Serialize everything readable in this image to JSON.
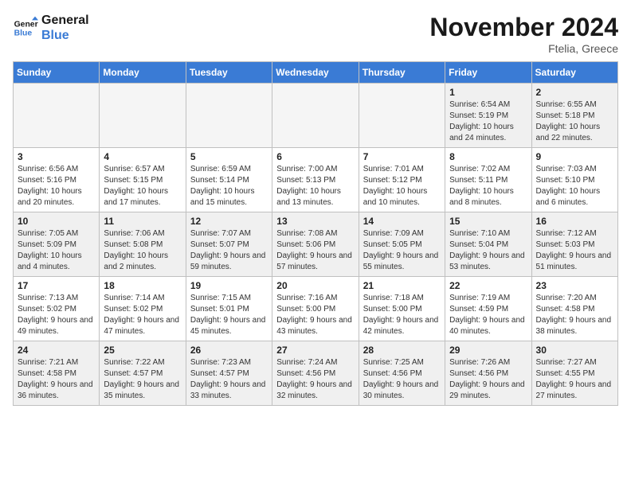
{
  "header": {
    "logo_line1": "General",
    "logo_line2": "Blue",
    "month_title": "November 2024",
    "location": "Ftelia, Greece"
  },
  "weekdays": [
    "Sunday",
    "Monday",
    "Tuesday",
    "Wednesday",
    "Thursday",
    "Friday",
    "Saturday"
  ],
  "weeks": [
    [
      {
        "day": "",
        "info": "",
        "empty": true
      },
      {
        "day": "",
        "info": "",
        "empty": true
      },
      {
        "day": "",
        "info": "",
        "empty": true
      },
      {
        "day": "",
        "info": "",
        "empty": true
      },
      {
        "day": "",
        "info": "",
        "empty": true
      },
      {
        "day": "1",
        "info": "Sunrise: 6:54 AM\nSunset: 5:19 PM\nDaylight: 10 hours and 24 minutes."
      },
      {
        "day": "2",
        "info": "Sunrise: 6:55 AM\nSunset: 5:18 PM\nDaylight: 10 hours and 22 minutes."
      }
    ],
    [
      {
        "day": "3",
        "info": "Sunrise: 6:56 AM\nSunset: 5:16 PM\nDaylight: 10 hours and 20 minutes."
      },
      {
        "day": "4",
        "info": "Sunrise: 6:57 AM\nSunset: 5:15 PM\nDaylight: 10 hours and 17 minutes."
      },
      {
        "day": "5",
        "info": "Sunrise: 6:59 AM\nSunset: 5:14 PM\nDaylight: 10 hours and 15 minutes."
      },
      {
        "day": "6",
        "info": "Sunrise: 7:00 AM\nSunset: 5:13 PM\nDaylight: 10 hours and 13 minutes."
      },
      {
        "day": "7",
        "info": "Sunrise: 7:01 AM\nSunset: 5:12 PM\nDaylight: 10 hours and 10 minutes."
      },
      {
        "day": "8",
        "info": "Sunrise: 7:02 AM\nSunset: 5:11 PM\nDaylight: 10 hours and 8 minutes."
      },
      {
        "day": "9",
        "info": "Sunrise: 7:03 AM\nSunset: 5:10 PM\nDaylight: 10 hours and 6 minutes."
      }
    ],
    [
      {
        "day": "10",
        "info": "Sunrise: 7:05 AM\nSunset: 5:09 PM\nDaylight: 10 hours and 4 minutes."
      },
      {
        "day": "11",
        "info": "Sunrise: 7:06 AM\nSunset: 5:08 PM\nDaylight: 10 hours and 2 minutes."
      },
      {
        "day": "12",
        "info": "Sunrise: 7:07 AM\nSunset: 5:07 PM\nDaylight: 9 hours and 59 minutes."
      },
      {
        "day": "13",
        "info": "Sunrise: 7:08 AM\nSunset: 5:06 PM\nDaylight: 9 hours and 57 minutes."
      },
      {
        "day": "14",
        "info": "Sunrise: 7:09 AM\nSunset: 5:05 PM\nDaylight: 9 hours and 55 minutes."
      },
      {
        "day": "15",
        "info": "Sunrise: 7:10 AM\nSunset: 5:04 PM\nDaylight: 9 hours and 53 minutes."
      },
      {
        "day": "16",
        "info": "Sunrise: 7:12 AM\nSunset: 5:03 PM\nDaylight: 9 hours and 51 minutes."
      }
    ],
    [
      {
        "day": "17",
        "info": "Sunrise: 7:13 AM\nSunset: 5:02 PM\nDaylight: 9 hours and 49 minutes."
      },
      {
        "day": "18",
        "info": "Sunrise: 7:14 AM\nSunset: 5:02 PM\nDaylight: 9 hours and 47 minutes."
      },
      {
        "day": "19",
        "info": "Sunrise: 7:15 AM\nSunset: 5:01 PM\nDaylight: 9 hours and 45 minutes."
      },
      {
        "day": "20",
        "info": "Sunrise: 7:16 AM\nSunset: 5:00 PM\nDaylight: 9 hours and 43 minutes."
      },
      {
        "day": "21",
        "info": "Sunrise: 7:18 AM\nSunset: 5:00 PM\nDaylight: 9 hours and 42 minutes."
      },
      {
        "day": "22",
        "info": "Sunrise: 7:19 AM\nSunset: 4:59 PM\nDaylight: 9 hours and 40 minutes."
      },
      {
        "day": "23",
        "info": "Sunrise: 7:20 AM\nSunset: 4:58 PM\nDaylight: 9 hours and 38 minutes."
      }
    ],
    [
      {
        "day": "24",
        "info": "Sunrise: 7:21 AM\nSunset: 4:58 PM\nDaylight: 9 hours and 36 minutes."
      },
      {
        "day": "25",
        "info": "Sunrise: 7:22 AM\nSunset: 4:57 PM\nDaylight: 9 hours and 35 minutes."
      },
      {
        "day": "26",
        "info": "Sunrise: 7:23 AM\nSunset: 4:57 PM\nDaylight: 9 hours and 33 minutes."
      },
      {
        "day": "27",
        "info": "Sunrise: 7:24 AM\nSunset: 4:56 PM\nDaylight: 9 hours and 32 minutes."
      },
      {
        "day": "28",
        "info": "Sunrise: 7:25 AM\nSunset: 4:56 PM\nDaylight: 9 hours and 30 minutes."
      },
      {
        "day": "29",
        "info": "Sunrise: 7:26 AM\nSunset: 4:56 PM\nDaylight: 9 hours and 29 minutes."
      },
      {
        "day": "30",
        "info": "Sunrise: 7:27 AM\nSunset: 4:55 PM\nDaylight: 9 hours and 27 minutes."
      }
    ]
  ]
}
